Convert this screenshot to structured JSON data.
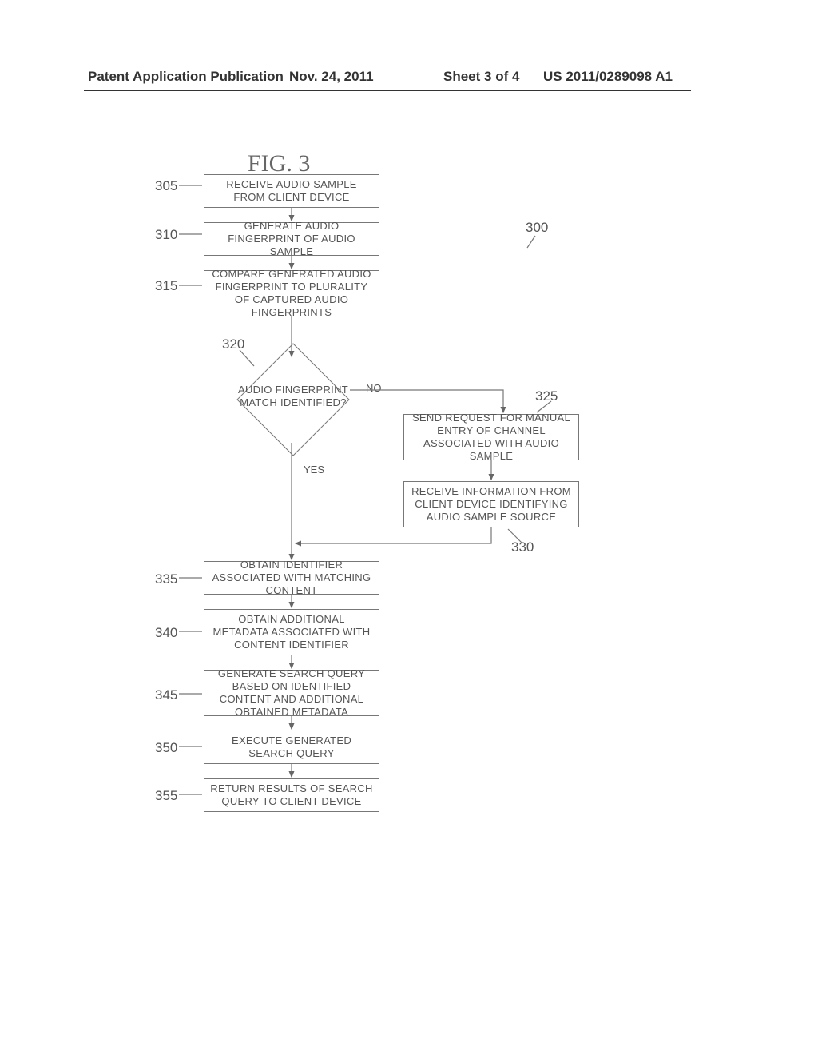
{
  "header": {
    "left": "Patent Application Publication",
    "date": "Nov. 24, 2011",
    "sheet": "Sheet 3 of 4",
    "pubno": "US 2011/0289098 A1"
  },
  "figure": {
    "title": "FIG. 3",
    "overall_ref": "300"
  },
  "refs": {
    "r305": "305",
    "r310": "310",
    "r315": "315",
    "r320": "320",
    "r325": "325",
    "r330": "330",
    "r335": "335",
    "r340": "340",
    "r345": "345",
    "r350": "350",
    "r355": "355"
  },
  "boxes": {
    "b305": "RECEIVE AUDIO SAMPLE FROM CLIENT DEVICE",
    "b310": "GENERATE AUDIO FINGERPRINT OF AUDIO SAMPLE",
    "b315": "COMPARE GENERATED AUDIO FINGERPRINT TO PLURALITY OF CAPTURED AUDIO FINGERPRINTS",
    "b320": "AUDIO FINGERPRINT MATCH IDENTIFIED?",
    "b325": "SEND REQUEST FOR MANUAL ENTRY OF CHANNEL ASSOCIATED WITH AUDIO SAMPLE",
    "b330": "RECEIVE INFORMATION FROM CLIENT DEVICE IDENTIFYING AUDIO SAMPLE SOURCE",
    "b335": "OBTAIN IDENTIFIER ASSOCIATED WITH MATCHING CONTENT",
    "b340": "OBTAIN ADDITIONAL METADATA ASSOCIATED WITH CONTENT IDENTIFIER",
    "b345": "GENERATE SEARCH QUERY BASED ON IDENTIFIED CONTENT AND ADDITIONAL OBTAINED METADATA",
    "b350": "EXECUTE GENERATED SEARCH QUERY",
    "b355": "RETURN RESULTS OF SEARCH QUERY TO CLIENT DEVICE"
  },
  "edges": {
    "no": "NO",
    "yes": "YES"
  },
  "chart_data": {
    "type": "flowchart",
    "title": "FIG. 3",
    "nodes": [
      {
        "id": "305",
        "type": "process",
        "label": "RECEIVE AUDIO SAMPLE FROM CLIENT DEVICE"
      },
      {
        "id": "310",
        "type": "process",
        "label": "GENERATE AUDIO FINGERPRINT OF AUDIO SAMPLE"
      },
      {
        "id": "315",
        "type": "process",
        "label": "COMPARE GENERATED AUDIO FINGERPRINT TO PLURALITY OF CAPTURED AUDIO FINGERPRINTS"
      },
      {
        "id": "320",
        "type": "decision",
        "label": "AUDIO FINGERPRINT MATCH IDENTIFIED?"
      },
      {
        "id": "325",
        "type": "process",
        "label": "SEND REQUEST FOR MANUAL ENTRY OF CHANNEL ASSOCIATED WITH AUDIO SAMPLE"
      },
      {
        "id": "330",
        "type": "process",
        "label": "RECEIVE INFORMATION FROM CLIENT DEVICE IDENTIFYING AUDIO SAMPLE SOURCE"
      },
      {
        "id": "335",
        "type": "process",
        "label": "OBTAIN IDENTIFIER ASSOCIATED WITH MATCHING CONTENT"
      },
      {
        "id": "340",
        "type": "process",
        "label": "OBTAIN ADDITIONAL METADATA ASSOCIATED WITH CONTENT IDENTIFIER"
      },
      {
        "id": "345",
        "type": "process",
        "label": "GENERATE SEARCH QUERY BASED ON IDENTIFIED CONTENT AND ADDITIONAL OBTAINED METADATA"
      },
      {
        "id": "350",
        "type": "process",
        "label": "EXECUTE GENERATED SEARCH QUERY"
      },
      {
        "id": "355",
        "type": "process",
        "label": "RETURN RESULTS OF SEARCH QUERY TO CLIENT DEVICE"
      }
    ],
    "edges": [
      {
        "from": "305",
        "to": "310"
      },
      {
        "from": "310",
        "to": "315"
      },
      {
        "from": "315",
        "to": "320"
      },
      {
        "from": "320",
        "to": "325",
        "label": "NO"
      },
      {
        "from": "320",
        "to": "335",
        "label": "YES"
      },
      {
        "from": "325",
        "to": "330"
      },
      {
        "from": "330",
        "to": "335"
      },
      {
        "from": "335",
        "to": "340"
      },
      {
        "from": "340",
        "to": "345"
      },
      {
        "from": "345",
        "to": "350"
      },
      {
        "from": "350",
        "to": "355"
      }
    ],
    "overall_ref": "300"
  }
}
